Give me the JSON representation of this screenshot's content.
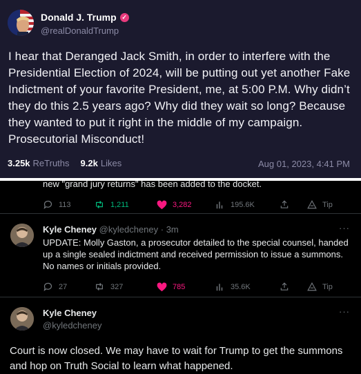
{
  "truth": {
    "author_name": "Donald J. Trump",
    "author_handle": "@realDonaldTrump",
    "body": "I hear that Deranged Jack Smith, in order to interfere with the Presidential Election of 2024, will be putting out yet another Fake Indictment of your favorite President, me, at 5:00 P.M. Why didn’t they do this 2.5 years ago? Why did they wait so long? Because they wanted to put it right in the middle of my campaign. Prosecutorial Misconduct!",
    "retruths_count": "3.25k",
    "retruths_label": "ReTruths",
    "likes_count": "9.2k",
    "likes_label": "Likes",
    "date": "Aug 01, 2023, 4:41 PM"
  },
  "colors": {
    "truth_bg": "#1b1a2e",
    "verified": "#e93b7d",
    "retweet_green": "#00ba7c",
    "like_pink": "#f91880",
    "muted": "#71767b"
  },
  "twitter": {
    "cut_text": "new \"grand jury returns\" has been added to the docket.",
    "tweet1_actions": {
      "replies": "113",
      "retweets": "1,211",
      "likes": "3,282",
      "views": "195.6K",
      "tip": "Tip"
    },
    "tweet2": {
      "name": "Kyle Cheney",
      "meta": "@kyledcheney · 3m",
      "text": "UPDATE: Molly Gaston, a prosecutor detailed to the special counsel, handed up a single sealed indictment and received permission to issue a summons. No names or initials provided.",
      "replies": "27",
      "retweets": "327",
      "likes": "785",
      "views": "35.6K",
      "tip": "Tip"
    },
    "tweet3": {
      "name": "Kyle Cheney",
      "handle": "@kyledcheney",
      "text": "Court is now closed. We may have to wait for Trump to get the summons and hop on Truth Social to learn what happened."
    },
    "icons": [
      "reply-icon",
      "retweet-icon",
      "heart-icon",
      "views-icon",
      "share-icon",
      "tip-icon",
      "more-icon"
    ]
  }
}
